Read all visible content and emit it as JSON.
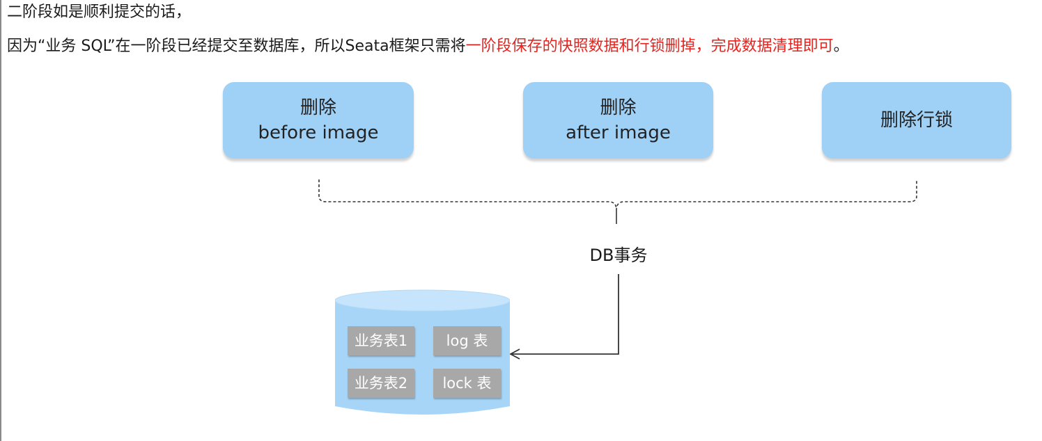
{
  "intro": {
    "line1": "二阶段如是顺利提交的话，",
    "line2_normal": "因为“业务 SQL”在一阶段已经提交至数据库，所以Seata框架只需将",
    "line2_highlight": "一阶段保存的快照数据和行锁删掉，完成数据清理即可",
    "line2_end": "。"
  },
  "actions": [
    {
      "line1": "删除",
      "line2": "before image"
    },
    {
      "line1": "删除",
      "line2": "after image"
    },
    {
      "line1": "删除行锁",
      "line2": ""
    }
  ],
  "db_transaction_label": "DB事务",
  "database": {
    "tables": [
      "业务表1",
      "log 表",
      "业务表2",
      "lock 表"
    ]
  },
  "colors": {
    "box_fill": "#9fd0f6",
    "highlight_text": "#e6231e",
    "cylinder_top": "#c6e4fb",
    "cylinder_body": "#a7d5f7",
    "table_cell": "#a8a8a8"
  }
}
